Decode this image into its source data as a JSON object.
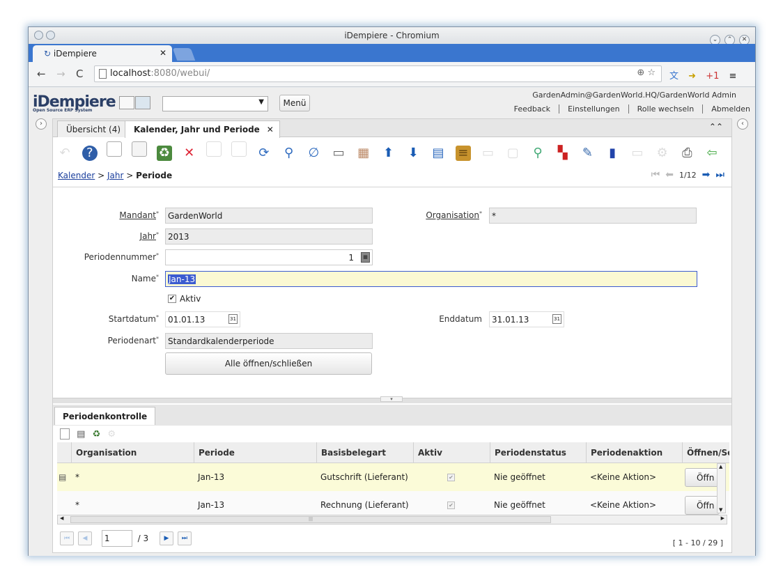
{
  "browser": {
    "window_title": "iDempiere - Chromium",
    "tab_title": "iDempiere",
    "url_host": "localhost",
    "url_rest": ":8080/webui/"
  },
  "header": {
    "logo": "iDempiere",
    "logo_sub": "Open Source ERP System",
    "menu_label": "Menü",
    "user": "GardenAdmin@GardenWorld.HQ/GardenWorld Admin",
    "links": [
      "Feedback",
      "Einstellungen",
      "Rolle wechseln",
      "Abmelden"
    ]
  },
  "window_tabs": [
    "Übersicht (4)",
    "Kalender, Jahr und Periode"
  ],
  "breadcrumb": {
    "item1": "Kalender",
    "sep": ">",
    "item2": "Jahr",
    "current": "Periode"
  },
  "record_pager": "1/12",
  "form": {
    "mandant_label": "Mandant",
    "mandant_value": "GardenWorld",
    "organisation_label": "Organisation",
    "organisation_value": "*",
    "jahr_label": "Jahr",
    "jahr_value": "2013",
    "periodennummer_label": "Periodennummer",
    "periodennummer_value": "1",
    "name_label": "Name",
    "name_value": "Jan-13",
    "aktiv_label": "Aktiv",
    "startdatum_label": "Startdatum",
    "startdatum_value": "01.01.13",
    "enddatum_label": "Enddatum",
    "enddatum_value": "31.01.13",
    "periodenart_label": "Periodenart",
    "periodenart_value": "Standardkalenderperiode",
    "toggle_button": "Alle öffnen/schließen",
    "required_mark": "*",
    "cal_icon_text": "31"
  },
  "detail": {
    "tab_label": "Periodenkontrolle",
    "columns": [
      "Organisation",
      "Periode",
      "Basisbelegart",
      "Aktiv",
      "Periodenstatus",
      "Periodenaktion",
      "Öffnen/Sc"
    ],
    "rows": [
      {
        "org": "*",
        "periode": "Jan-13",
        "basis": "Gutschrift (Lieferant)",
        "status": "Nie geöffnet",
        "aktion": "<Keine Aktion>",
        "btn": "Öffn"
      },
      {
        "org": "*",
        "periode": "Jan-13",
        "basis": "Rechnung (Lieferant)",
        "status": "Nie geöffnet",
        "aktion": "<Keine Aktion>",
        "btn": "Öffn"
      }
    ],
    "page_value": "1",
    "page_total": "/ 3",
    "range": "[ 1 - 10 / 29 ]"
  }
}
